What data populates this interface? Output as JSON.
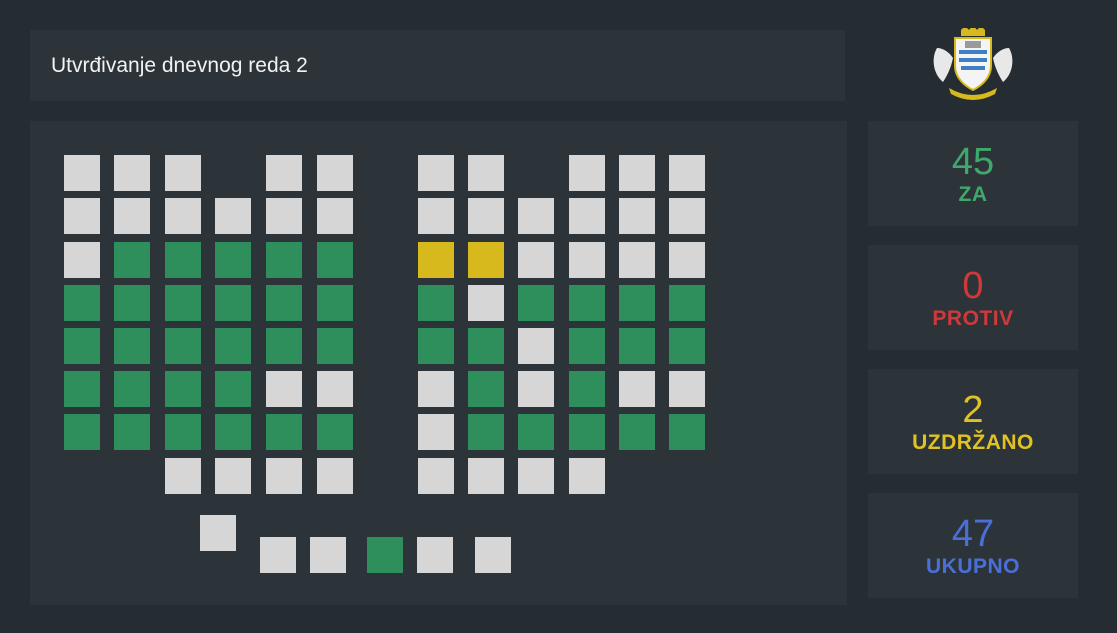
{
  "header": {
    "title": "Utvrđivanje dnevnog reda 2"
  },
  "logo": {
    "name": "coat-of-arms-icon"
  },
  "stats": [
    {
      "id": "za",
      "value": "45",
      "label": "ZA",
      "color": "#3fa86a"
    },
    {
      "id": "protiv",
      "value": "0",
      "label": "PROTIV",
      "color": "#d0393a"
    },
    {
      "id": "uzdrzano",
      "value": "2",
      "label": "UZDRŽANO",
      "color": "#e1c225"
    },
    {
      "id": "ukupno",
      "value": "47",
      "label": "UKUPNO",
      "color": "#4a6fd8"
    }
  ],
  "colors": {
    "background": "#252d33",
    "panel": "#2c3439",
    "seat_blank": "#d6d6d6",
    "seat_za": "#2f8f5c",
    "seat_uzdrzano": "#d7b91e"
  },
  "seating": {
    "rows": [
      [
        "blank",
        "blank",
        "blank",
        "none",
        "blank",
        "blank",
        "none",
        "blank",
        "blank",
        "none",
        "blank",
        "blank",
        "blank"
      ],
      [
        "blank",
        "blank",
        "blank",
        "blank",
        "blank",
        "blank",
        "none",
        "blank",
        "blank",
        "blank",
        "blank",
        "blank",
        "blank"
      ],
      [
        "blank",
        "za",
        "za",
        "za",
        "za",
        "za",
        "none",
        "uzdrzano",
        "uzdrzano",
        "blank",
        "blank",
        "blank",
        "blank"
      ],
      [
        "za",
        "za",
        "za",
        "za",
        "za",
        "za",
        "none",
        "za",
        "blank",
        "za",
        "za",
        "za",
        "za"
      ],
      [
        "za",
        "za",
        "za",
        "za",
        "za",
        "za",
        "none",
        "za",
        "za",
        "blank",
        "za",
        "za",
        "za"
      ],
      [
        "za",
        "za",
        "za",
        "za",
        "blank",
        "blank",
        "none",
        "blank",
        "za",
        "blank",
        "za",
        "blank",
        "blank"
      ],
      [
        "za",
        "za",
        "za",
        "za",
        "za",
        "za",
        "none",
        "blank",
        "za",
        "za",
        "za",
        "za",
        "za"
      ],
      [
        "none",
        "none",
        "blank",
        "blank",
        "blank",
        "blank",
        "none",
        "blank",
        "blank",
        "blank",
        "blank",
        "none",
        "none"
      ]
    ],
    "front": [
      "blank",
      "blank",
      "blank",
      "za",
      "blank",
      "blank"
    ]
  }
}
